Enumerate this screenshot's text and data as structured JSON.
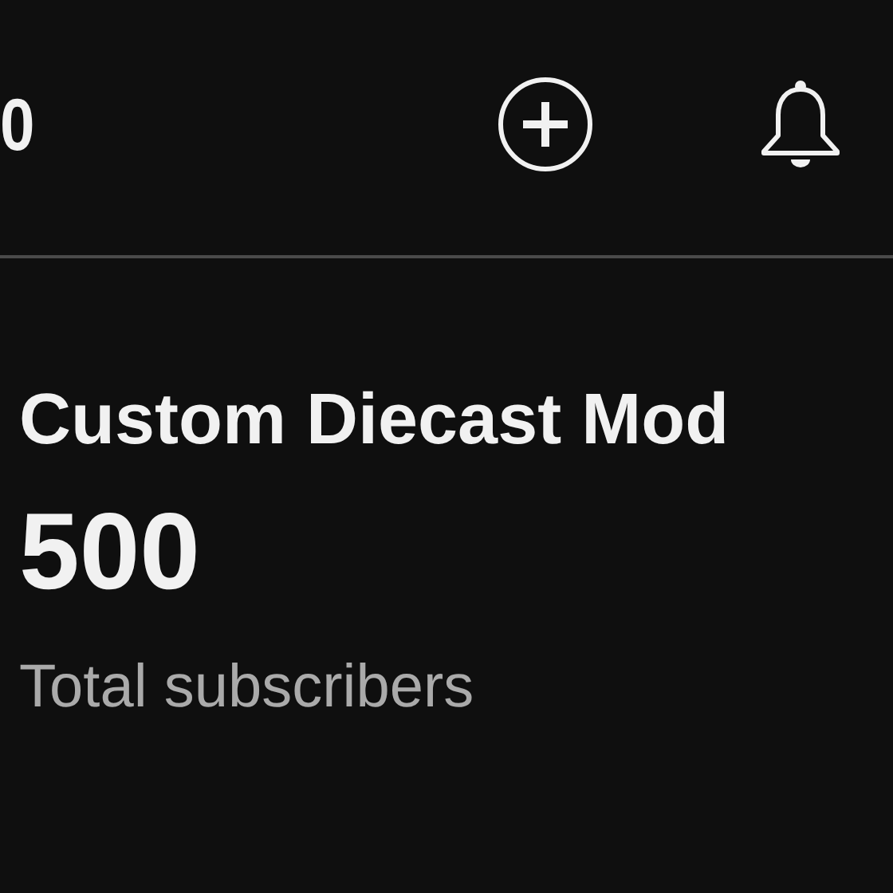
{
  "header": {
    "title": "0",
    "actions": [
      {
        "kind": "add"
      },
      {
        "kind": "notifications"
      }
    ]
  },
  "channel": {
    "name": "Custom Diecast Mod",
    "subscriber_count": "500",
    "subscriber_label": "Total subscribers"
  }
}
